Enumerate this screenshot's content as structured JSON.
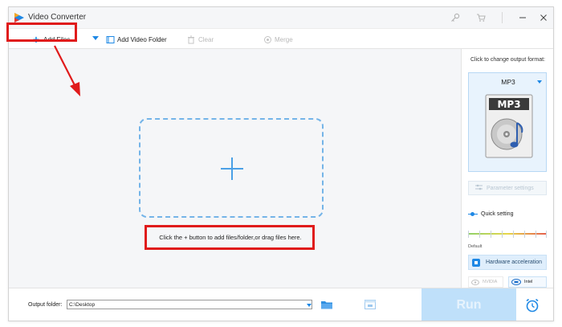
{
  "window": {
    "title": "Video Converter"
  },
  "toolbar": {
    "add_files": "Add Files",
    "add_video_folder": "Add Video Folder",
    "clear": "Clear",
    "merge": "Merge"
  },
  "main": {
    "hint": "Click the + button to add files/folder,or drag files here."
  },
  "right_panel": {
    "title": "Click to change output format:",
    "format": "MP3",
    "format_icon_text": "MP3",
    "parameter_settings": "Parameter settings",
    "quick_setting": "Quick setting",
    "quality_default": "Default",
    "hardware_acceleration": "Hardware acceleration",
    "nvidia": "NVIDIA",
    "intel": "Intel"
  },
  "bottom": {
    "output_folder_label": "Output folder:",
    "output_folder_value": "C:\\Desktop",
    "run": "Run"
  },
  "colors": {
    "accent": "#1e88e5",
    "highlight_red": "#e01b1b",
    "run_button": "#bfe0fa",
    "drop_zone_border": "#74b4e8"
  },
  "icons": {
    "app": "app-logo-icon",
    "key": "key-icon",
    "cart": "cart-icon",
    "add": "plus-icon",
    "folder": "folder-icon",
    "clear": "trash-icon",
    "merge": "merge-icon",
    "alarm": "alarm-clock-icon"
  }
}
